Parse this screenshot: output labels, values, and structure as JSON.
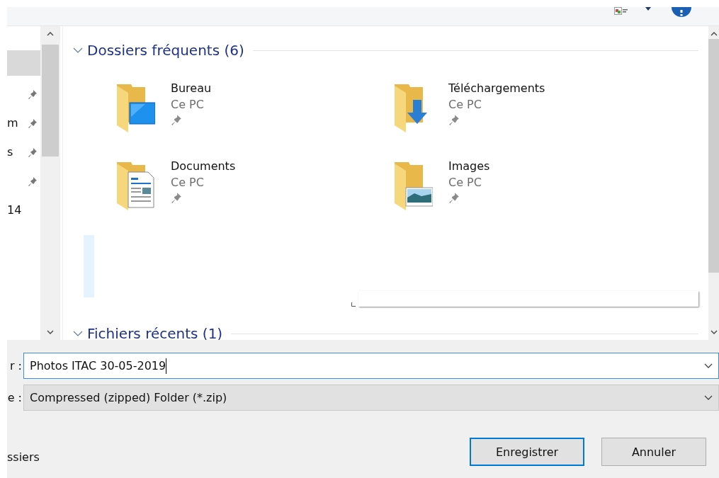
{
  "nav_items": [
    {
      "selected": true,
      "pinned": false
    },
    {
      "selected": false,
      "pinned": true
    },
    {
      "label": "m",
      "selected": false,
      "pinned": true
    },
    {
      "label": "s",
      "selected": false,
      "pinned": true
    },
    {
      "selected": false,
      "pinned": true
    },
    {
      "label": "14",
      "selected": false,
      "pinned": false
    }
  ],
  "sections": [
    {
      "title": "Dossiers fréquents (6)",
      "expanded": true,
      "folders": [
        {
          "name": "Bureau",
          "location": "Ce PC",
          "kind": "desktop",
          "pinned": true
        },
        {
          "name": "Téléchargements",
          "location": "Ce PC",
          "kind": "download",
          "pinned": true
        },
        {
          "name": "Documents",
          "location": "Ce PC",
          "kind": "document",
          "pinned": true
        },
        {
          "name": "Images",
          "location": "Ce PC",
          "kind": "pictures",
          "pinned": true
        }
      ]
    },
    {
      "title": "Fichiers récents (1)",
      "expanded": true
    }
  ],
  "filename": {
    "label": "r :",
    "value": "Photos ITAC 30-05-2019"
  },
  "filetype": {
    "label": "e :",
    "value": "Compressed (zipped) Folder (*.zip)"
  },
  "hide_folders": "ssiers",
  "buttons": [
    {
      "label": "Enregistrer",
      "kind": "primary"
    },
    {
      "label": "Annuler",
      "kind": "secondary"
    }
  ]
}
